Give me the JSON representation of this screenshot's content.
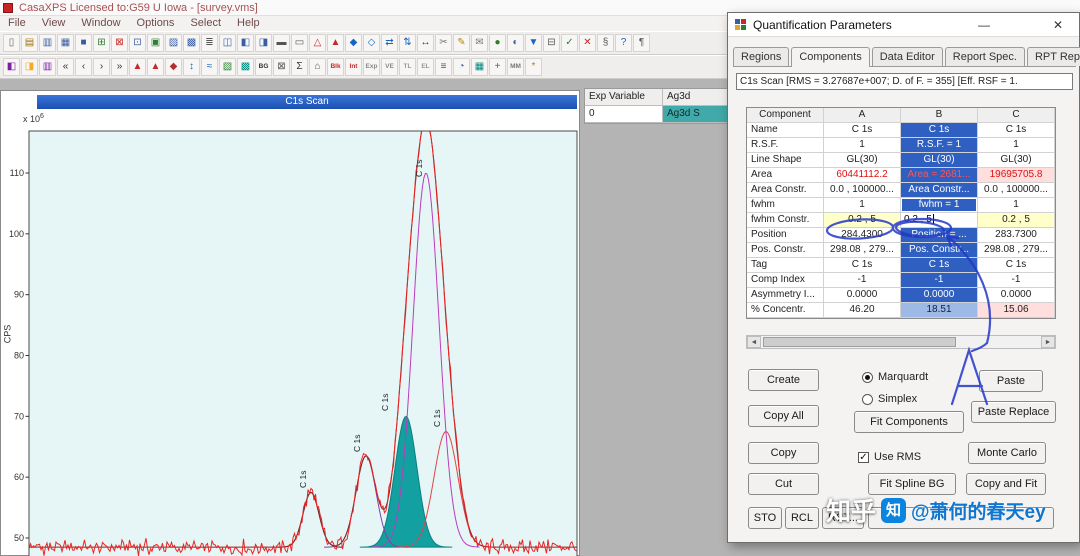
{
  "titlebar": {
    "title": "CasaXPS Licensed to:G59 U Iowa - [survey.vms]"
  },
  "menu": {
    "items": [
      "File",
      "View",
      "Window",
      "Options",
      "Select",
      "Help"
    ]
  },
  "toolbar1": {
    "icons": [
      {
        "g": "▯",
        "c": "#666"
      },
      {
        "g": "▤",
        "c": "#a0720a"
      },
      {
        "g": "▥",
        "c": "#3a5fa0"
      },
      {
        "g": "▦",
        "c": "#3a5fa0"
      },
      {
        "g": "■",
        "c": "#355e9e"
      },
      {
        "g": "⊞",
        "c": "#2e7d32"
      },
      {
        "g": "⊠",
        "c": "#c62828"
      },
      {
        "g": "⊡",
        "c": "#3a5fa0"
      },
      {
        "g": "▣",
        "c": "#2e7d32"
      },
      {
        "g": "▨",
        "c": "#3a5fa0"
      },
      {
        "g": "▩",
        "c": "#3a5fa0"
      },
      {
        "g": "≣",
        "c": "#555"
      },
      {
        "g": "◫",
        "c": "#3a5fa0"
      },
      {
        "g": "◧",
        "c": "#3a5fa0"
      },
      {
        "g": "◨",
        "c": "#3a5fa0"
      },
      {
        "g": "▬",
        "c": "#555"
      },
      {
        "g": "▭",
        "c": "#555"
      },
      {
        "g": "△",
        "c": "#c62828"
      },
      {
        "g": "▲",
        "c": "#c62828"
      },
      {
        "g": "◆",
        "c": "#1565c0"
      },
      {
        "g": "◇",
        "c": "#1565c0"
      },
      {
        "g": "⇄",
        "c": "#1565c0"
      },
      {
        "g": "⇅",
        "c": "#1565c0"
      },
      {
        "g": "↔",
        "c": "#333"
      },
      {
        "g": "✂",
        "c": "#777"
      },
      {
        "g": "✎",
        "c": "#b8860b"
      },
      {
        "g": "✉",
        "c": "#777"
      },
      {
        "g": "●",
        "c": "#2e7d32"
      },
      {
        "g": "◐",
        "c": "#3a5fa0"
      },
      {
        "g": "▼",
        "c": "#1565c0"
      },
      {
        "g": "⊟",
        "c": "#555"
      },
      {
        "g": "✓",
        "c": "#2e7d32"
      },
      {
        "g": "✕",
        "c": "#c62828"
      },
      {
        "g": "§",
        "c": "#555"
      },
      {
        "g": "?",
        "c": "#1565c0"
      },
      {
        "g": "¶",
        "c": "#555"
      }
    ]
  },
  "toolbar2": {
    "icons": [
      {
        "g": "◧",
        "c": "#7b1fa2"
      },
      {
        "g": "◨",
        "c": "#f9a825"
      },
      {
        "g": "▥",
        "c": "#7b1fa2"
      },
      {
        "g": "«",
        "c": "#333"
      },
      {
        "g": "‹",
        "c": "#333"
      },
      {
        "g": "›",
        "c": "#333"
      },
      {
        "g": "»",
        "c": "#333"
      },
      {
        "g": "▲",
        "c": "#c62828"
      },
      {
        "g": "▲",
        "c": "#c62828"
      },
      {
        "g": "◆",
        "c": "#b03030"
      },
      {
        "g": "↕",
        "c": "#1565c0"
      },
      {
        "g": "≈",
        "c": "#1565c0"
      },
      {
        "g": "▧",
        "c": "#2e7d32"
      },
      {
        "g": "▩",
        "c": "#00897b"
      },
      {
        "g": "BG",
        "c": "#333",
        "s": 1
      },
      {
        "g": "⊠",
        "c": "#555"
      },
      {
        "g": "Σ",
        "c": "#333"
      },
      {
        "g": "⌂",
        "c": "#555"
      },
      {
        "g": "Blk",
        "c": "#c62828",
        "s": 1
      },
      {
        "g": "Int",
        "c": "#c62828",
        "s": 1
      },
      {
        "g": "Exp",
        "c": "#888",
        "s": 1
      },
      {
        "g": "VE",
        "c": "#888",
        "s": 1
      },
      {
        "g": "TL",
        "c": "#999",
        "s": 1
      },
      {
        "g": "EL",
        "c": "#999",
        "s": 1
      },
      {
        "g": "≡",
        "c": "#555"
      },
      {
        "g": "◔",
        "c": "#3a5fa0"
      },
      {
        "g": "▦",
        "c": "#00897b"
      },
      {
        "g": "+",
        "c": "#2e7d32"
      },
      {
        "g": "MM",
        "c": "#777",
        "s": 1
      },
      {
        "g": "*",
        "c": "#b8860b"
      }
    ]
  },
  "chart_window": {
    "title": "C1s Scan",
    "y_axis_label": "CPS",
    "scale_prefix": "x 10",
    "scale_exp": "6",
    "peak_label": "C 1s",
    "plot": {
      "y_ticks": [
        110,
        100,
        90,
        80,
        70,
        60,
        50
      ],
      "baseline": 48.5,
      "peaks": [
        {
          "center": 310,
          "amp": 9,
          "sigma": 8,
          "color": "#2a2a2a",
          "fill": false,
          "label": [
            305,
            377
          ]
        },
        {
          "center": 365,
          "amp": 15,
          "sigma": 10,
          "color": "#8040a8",
          "fill": false,
          "label": [
            359,
            341
          ]
        },
        {
          "center": 405,
          "amp": 21.5,
          "sigma": 11,
          "color": "#12a0a0",
          "fill": true,
          "label": [
            387,
            300
          ]
        },
        {
          "center": 445,
          "amp": 19,
          "sigma": 12,
          "color": "#e04545",
          "fill": false,
          "label": [
            439,
            316
          ]
        },
        {
          "center": 425,
          "amp": 61.5,
          "sigma": 13,
          "color": "#bb3cbb",
          "fill": false,
          "label": [
            421,
            66
          ]
        }
      ]
    }
  },
  "exp_panel": {
    "headers": [
      "Exp Variable",
      "Ag3d"
    ],
    "row": [
      "0",
      "Ag3d S"
    ]
  },
  "dialog": {
    "title": "Quantification Parameters",
    "window_controls": {
      "minimize": "—",
      "close": "✕"
    },
    "tabs": [
      "Regions",
      "Components",
      "Data Editor",
      "Report Spec.",
      "RPT Report"
    ],
    "active_tab": "Components",
    "formula": "C1s Scan [RMS = 3.27687e+007; D. of F. = 355] [Eff. RSF = 1.",
    "table": {
      "headers": [
        "Component",
        "A",
        "B",
        "C"
      ],
      "rows": [
        {
          "label": "Name",
          "cells": [
            {
              "t": "C 1s"
            },
            {
              "t": "C 1s",
              "s": "sel"
            },
            {
              "t": "C 1s"
            }
          ]
        },
        {
          "label": "R.S.F.",
          "cells": [
            {
              "t": "1"
            },
            {
              "t": "R.S.F. = 1",
              "s": "sel"
            },
            {
              "t": "1"
            }
          ]
        },
        {
          "label": "Line Shape",
          "cells": [
            {
              "t": "GL(30)"
            },
            {
              "t": "GL(30)",
              "s": "sel"
            },
            {
              "t": "GL(30)"
            }
          ]
        },
        {
          "label": "Area",
          "cells": [
            {
              "t": "60441112.2",
              "s": "red"
            },
            {
              "t": "Area = 2681...",
              "s": "sel red"
            },
            {
              "t": "19695705.8",
              "s": "red pink"
            }
          ]
        },
        {
          "label": "Area Constr.",
          "cells": [
            {
              "t": "0.0 , 100000..."
            },
            {
              "t": "Area Constr...",
              "s": "sel"
            },
            {
              "t": "0.0 , 100000..."
            }
          ]
        },
        {
          "label": "fwhm",
          "cells": [
            {
              "t": "1"
            },
            {
              "t": "fwhm = 1",
              "s": "sel boxed"
            },
            {
              "t": "1"
            }
          ]
        },
        {
          "label": "fwhm Constr.",
          "cells": [
            {
              "t": "0.2 , 5",
              "s": "yel"
            },
            {
              "t": "0.2 , 5",
              "s": "edit"
            },
            {
              "t": "0.2 , 5",
              "s": "yel"
            }
          ]
        },
        {
          "label": "Position",
          "cells": [
            {
              "t": "284.4300"
            },
            {
              "t": "Position = ...",
              "s": "sel"
            },
            {
              "t": "283.7300"
            }
          ]
        },
        {
          "label": "Pos. Constr.",
          "cells": [
            {
              "t": "298.08 , 279..."
            },
            {
              "t": "Pos. Constr...",
              "s": "sel"
            },
            {
              "t": "298.08 , 279..."
            }
          ]
        },
        {
          "label": "Tag",
          "cells": [
            {
              "t": "C 1s"
            },
            {
              "t": "C 1s",
              "s": "sel"
            },
            {
              "t": "C 1s"
            }
          ]
        },
        {
          "label": "Comp Index",
          "cells": [
            {
              "t": "-1"
            },
            {
              "t": "-1",
              "s": "sel"
            },
            {
              "t": "-1"
            }
          ]
        },
        {
          "label": "Asymmetry I...",
          "cells": [
            {
              "t": "0.0000"
            },
            {
              "t": "0.0000",
              "s": "sel"
            },
            {
              "t": "0.0000"
            }
          ]
        },
        {
          "label": "% Concentr.",
          "cells": [
            {
              "t": "46.20"
            },
            {
              "t": "18.51",
              "s": "sellight"
            },
            {
              "t": "15.06",
              "s": "pink"
            }
          ]
        }
      ]
    },
    "fit": {
      "marquardt": "Marquardt",
      "simplex": "Simplex",
      "selected": "Marquardt",
      "use_rms": "Use RMS",
      "use_rms_checked": "✓",
      "fit_components": "Fit Components",
      "fit_spline_bg": "Fit Spline BG"
    },
    "buttons": {
      "create": "Create",
      "copy_all": "Copy All",
      "copy": "Copy",
      "cut": "Cut",
      "sto": "STO",
      "rcl": "RCL",
      "rst": "RST...",
      "paste": "Paste",
      "paste_replace": "Paste Replace",
      "monte_carlo": "Monte Carlo",
      "copy_and_fit": "Copy and Fit"
    }
  },
  "watermark": {
    "brand": "知乎",
    "logo_char": "知",
    "handle": "@萧何的春天ey"
  }
}
